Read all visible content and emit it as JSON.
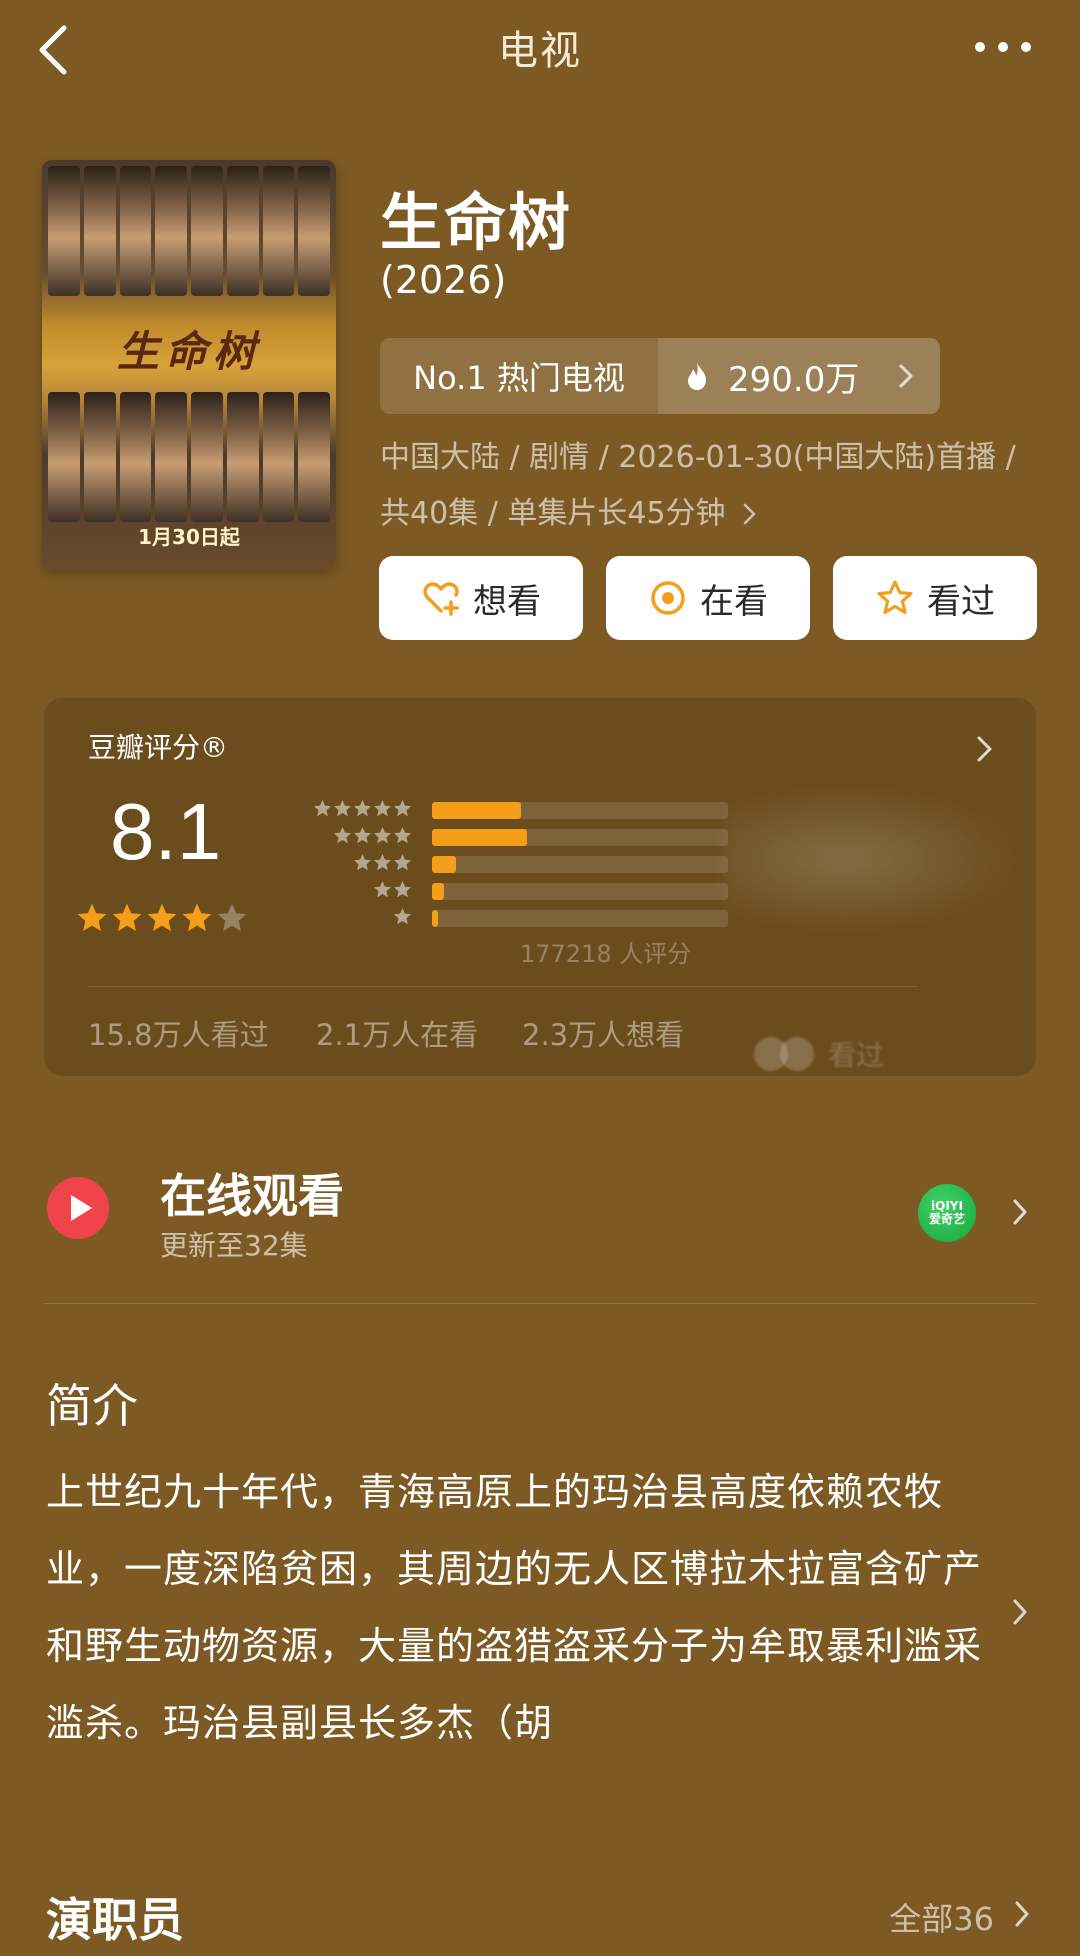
{
  "topbar": {
    "title": "电视"
  },
  "poster": {
    "title_art": "生命树",
    "release_note": "1月30日起"
  },
  "show": {
    "title": "生命树",
    "year": "(2026)"
  },
  "rank": {
    "label": "No.1 热门电视",
    "heat": "290.0万"
  },
  "meta": {
    "text": "中国大陆 / 剧情 / 2026-01-30(中国大陆)首播 / 共40集 / 单集片长45分钟"
  },
  "actions": {
    "want": "想看",
    "watching": "在看",
    "watched": "看过"
  },
  "rating": {
    "label": "豆瓣评分®",
    "score": "8.1",
    "stars": 4,
    "distribution": [
      {
        "stars": 5,
        "fraction": 0.3
      },
      {
        "stars": 4,
        "fraction": 0.32
      },
      {
        "stars": 3,
        "fraction": 0.08
      },
      {
        "stars": 2,
        "fraction": 0.04
      },
      {
        "stars": 1,
        "fraction": 0.02
      }
    ],
    "count": "177218 人评分",
    "stats": {
      "watched": "15.8万人看过",
      "watching": "2.1万人在看",
      "want": "2.3万人想看"
    },
    "friend_preview": "看过"
  },
  "online": {
    "title": "在线观看",
    "subtitle": "更新至32集",
    "provider_top": "iQIYI",
    "provider_bottom": "爱奇艺"
  },
  "intro": {
    "heading": "简介",
    "text": "上世纪九十年代，青海高原上的玛治县高度依赖农牧业，一度深陷贫困，其周边的无人区博拉木拉富含矿产和野生动物资源，大量的盗猎盗采分子为牟取暴利滥采滥杀。玛治县副县长多杰（胡"
  },
  "cast": {
    "heading": "演职员",
    "all": "全部36"
  },
  "colors": {
    "background": "#7d5a24",
    "accent": "#f59e1a",
    "play": "#f0444a",
    "iqiyi": "#17a83c"
  }
}
